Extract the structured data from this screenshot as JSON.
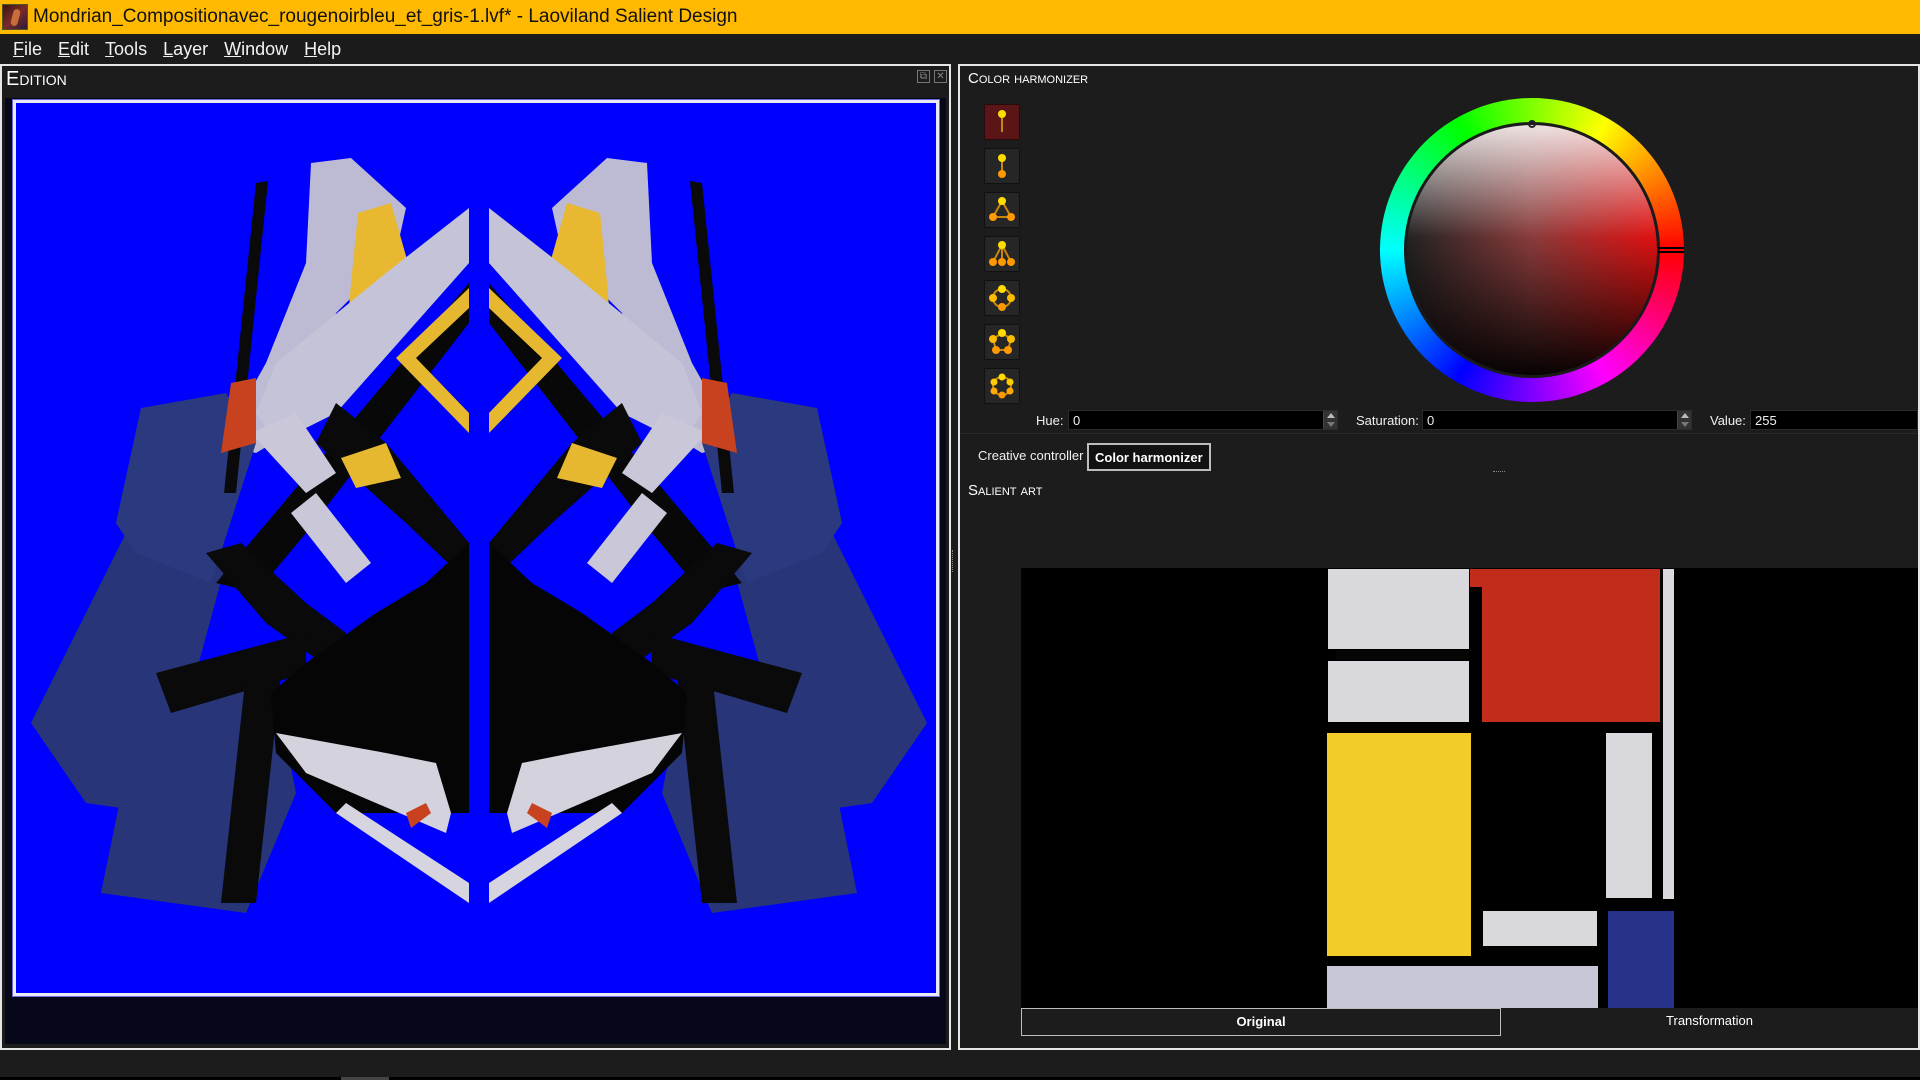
{
  "window": {
    "title": "Mondrian_Compositionavec_rougenoirbleu_et_gris-1.lvf* - Laoviland Salient Design",
    "app_icon": "app-logo-icon"
  },
  "menu": [
    {
      "label_u": "F",
      "label_rest": "ile"
    },
    {
      "label_u": "E",
      "label_rest": "dit"
    },
    {
      "label_u": "T",
      "label_rest": "ools"
    },
    {
      "label_u": "L",
      "label_rest": "ayer"
    },
    {
      "label_u": "W",
      "label_rest": "indow"
    },
    {
      "label_u": "H",
      "label_rest": "elp"
    }
  ],
  "edition": {
    "title": "Edition",
    "float_icon": "float-window-icon",
    "close_icon": "close-icon",
    "canvas_background": "#0000fd"
  },
  "harmonizer": {
    "title": "Color harmonizer",
    "harmony_types": [
      {
        "name": "monochromatic",
        "active": true
      },
      {
        "name": "complementary",
        "active": false
      },
      {
        "name": "triadic",
        "active": false
      },
      {
        "name": "split-complementary",
        "active": false
      },
      {
        "name": "tetradic",
        "active": false
      },
      {
        "name": "pentadic",
        "active": false
      },
      {
        "name": "hexadic",
        "active": false
      }
    ],
    "hue_label": "Hue:",
    "hue_value": "0",
    "saturation_label": "Saturation:",
    "saturation_value": "0",
    "value_label": "Value:",
    "value_value": "255",
    "wheel_hue_deg": 0
  },
  "tabs": {
    "creative": "Creative controller",
    "harmonizer": "Color harmonizer"
  },
  "salient": {
    "title": "Salient art",
    "view_tabs": {
      "original": "Original",
      "transformation": "Transformation"
    },
    "colors": {
      "red": "#c12d1a",
      "yellow": "#f2cd2a",
      "blue": "#27338a",
      "gray": "#d9d8dc",
      "black": "#050505"
    }
  }
}
